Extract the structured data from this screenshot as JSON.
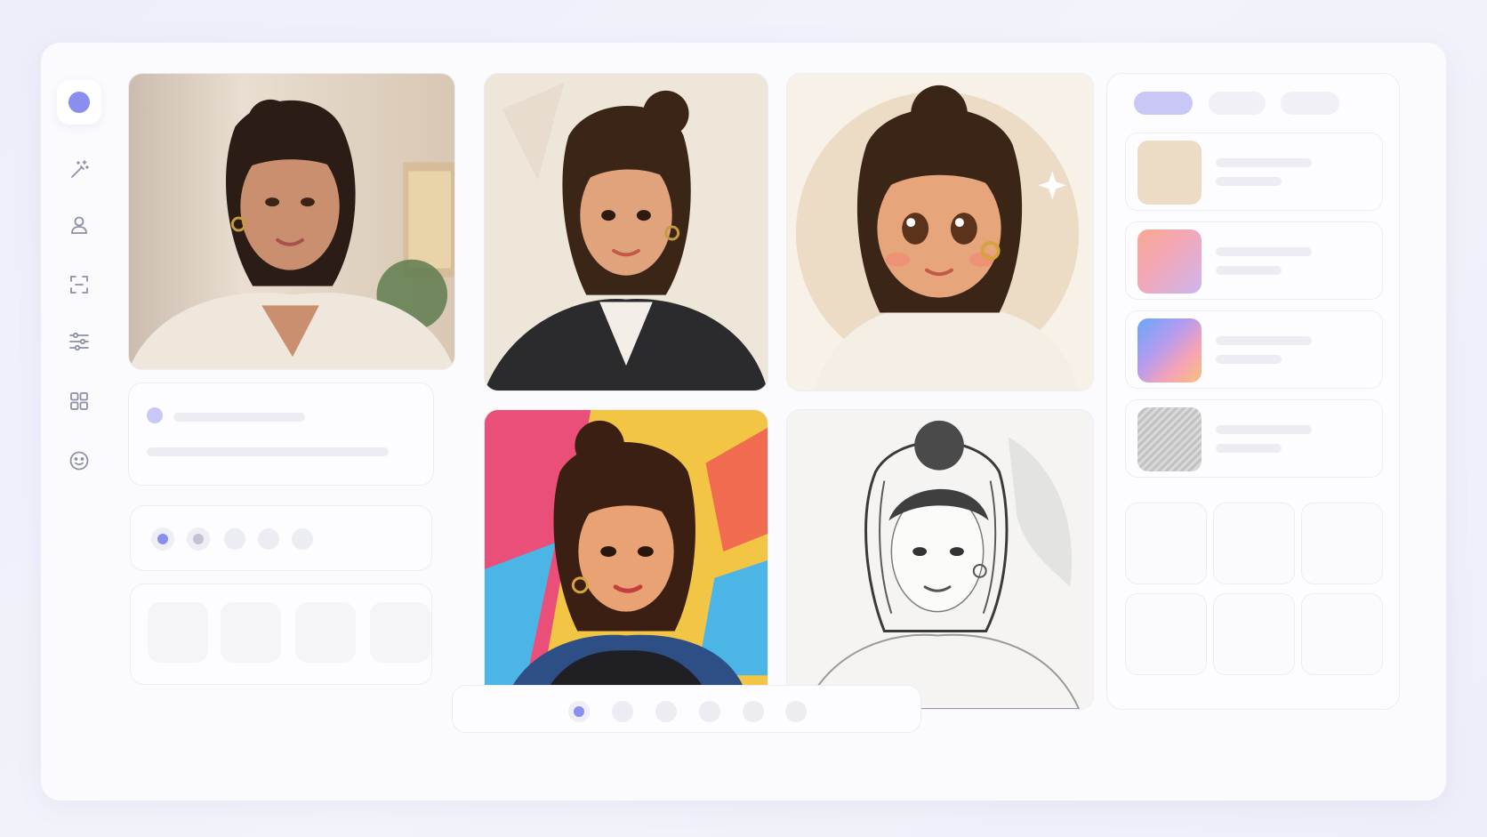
{
  "sidebar": {
    "items": [
      {
        "name": "magic-wand-icon"
      },
      {
        "name": "user-icon"
      },
      {
        "name": "crop-icon"
      },
      {
        "name": "sliders-icon"
      },
      {
        "name": "grid-icon"
      },
      {
        "name": "face-icon"
      }
    ]
  },
  "portraits": [
    {
      "style": "photo"
    },
    {
      "style": "illustrated-blazer"
    },
    {
      "style": "chibi-cartoon"
    },
    {
      "style": "pop-art"
    },
    {
      "style": "pencil-sketch"
    }
  ],
  "style_swatches": [
    {
      "name": "beige",
      "colors": [
        "#ecdcc6",
        "#f1e3cf"
      ]
    },
    {
      "name": "warm-gradient",
      "colors": [
        "#f9a890",
        "#cdb6ee"
      ]
    },
    {
      "name": "rainbow-gradient",
      "colors": [
        "#6aa7f6",
        "#f6c07c"
      ]
    },
    {
      "name": "sketch",
      "colors": [
        "#b8b8b8",
        "#d4d4d4"
      ]
    }
  ],
  "colors": {
    "accent": "#8a8eee",
    "accent_light": "#c9c7f6",
    "placeholder": "#ececf3"
  }
}
